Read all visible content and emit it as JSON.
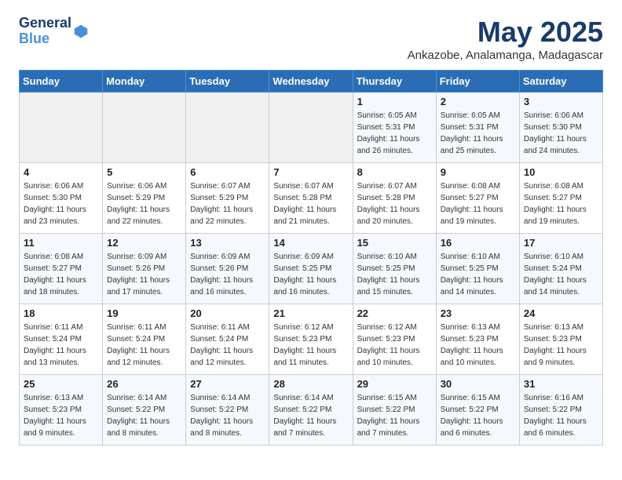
{
  "header": {
    "logo_line1": "General",
    "logo_line2": "Blue",
    "month": "May 2025",
    "location": "Ankazobe, Analamanga, Madagascar"
  },
  "weekdays": [
    "Sunday",
    "Monday",
    "Tuesday",
    "Wednesday",
    "Thursday",
    "Friday",
    "Saturday"
  ],
  "weeks": [
    [
      {
        "day": "",
        "sunrise": "",
        "sunset": "",
        "daylight": ""
      },
      {
        "day": "",
        "sunrise": "",
        "sunset": "",
        "daylight": ""
      },
      {
        "day": "",
        "sunrise": "",
        "sunset": "",
        "daylight": ""
      },
      {
        "day": "",
        "sunrise": "",
        "sunset": "",
        "daylight": ""
      },
      {
        "day": "1",
        "sunrise": "6:05 AM",
        "sunset": "5:31 PM",
        "daylight": "11 hours and 26 minutes."
      },
      {
        "day": "2",
        "sunrise": "6:05 AM",
        "sunset": "5:31 PM",
        "daylight": "11 hours and 25 minutes."
      },
      {
        "day": "3",
        "sunrise": "6:06 AM",
        "sunset": "5:30 PM",
        "daylight": "11 hours and 24 minutes."
      }
    ],
    [
      {
        "day": "4",
        "sunrise": "6:06 AM",
        "sunset": "5:30 PM",
        "daylight": "11 hours and 23 minutes."
      },
      {
        "day": "5",
        "sunrise": "6:06 AM",
        "sunset": "5:29 PM",
        "daylight": "11 hours and 22 minutes."
      },
      {
        "day": "6",
        "sunrise": "6:07 AM",
        "sunset": "5:29 PM",
        "daylight": "11 hours and 22 minutes."
      },
      {
        "day": "7",
        "sunrise": "6:07 AM",
        "sunset": "5:28 PM",
        "daylight": "11 hours and 21 minutes."
      },
      {
        "day": "8",
        "sunrise": "6:07 AM",
        "sunset": "5:28 PM",
        "daylight": "11 hours and 20 minutes."
      },
      {
        "day": "9",
        "sunrise": "6:08 AM",
        "sunset": "5:27 PM",
        "daylight": "11 hours and 19 minutes."
      },
      {
        "day": "10",
        "sunrise": "6:08 AM",
        "sunset": "5:27 PM",
        "daylight": "11 hours and 19 minutes."
      }
    ],
    [
      {
        "day": "11",
        "sunrise": "6:08 AM",
        "sunset": "5:27 PM",
        "daylight": "11 hours and 18 minutes."
      },
      {
        "day": "12",
        "sunrise": "6:09 AM",
        "sunset": "5:26 PM",
        "daylight": "11 hours and 17 minutes."
      },
      {
        "day": "13",
        "sunrise": "6:09 AM",
        "sunset": "5:26 PM",
        "daylight": "11 hours and 16 minutes."
      },
      {
        "day": "14",
        "sunrise": "6:09 AM",
        "sunset": "5:25 PM",
        "daylight": "11 hours and 16 minutes."
      },
      {
        "day": "15",
        "sunrise": "6:10 AM",
        "sunset": "5:25 PM",
        "daylight": "11 hours and 15 minutes."
      },
      {
        "day": "16",
        "sunrise": "6:10 AM",
        "sunset": "5:25 PM",
        "daylight": "11 hours and 14 minutes."
      },
      {
        "day": "17",
        "sunrise": "6:10 AM",
        "sunset": "5:24 PM",
        "daylight": "11 hours and 14 minutes."
      }
    ],
    [
      {
        "day": "18",
        "sunrise": "6:11 AM",
        "sunset": "5:24 PM",
        "daylight": "11 hours and 13 minutes."
      },
      {
        "day": "19",
        "sunrise": "6:11 AM",
        "sunset": "5:24 PM",
        "daylight": "11 hours and 12 minutes."
      },
      {
        "day": "20",
        "sunrise": "6:11 AM",
        "sunset": "5:24 PM",
        "daylight": "11 hours and 12 minutes."
      },
      {
        "day": "21",
        "sunrise": "6:12 AM",
        "sunset": "5:23 PM",
        "daylight": "11 hours and 11 minutes."
      },
      {
        "day": "22",
        "sunrise": "6:12 AM",
        "sunset": "5:23 PM",
        "daylight": "11 hours and 10 minutes."
      },
      {
        "day": "23",
        "sunrise": "6:13 AM",
        "sunset": "5:23 PM",
        "daylight": "11 hours and 10 minutes."
      },
      {
        "day": "24",
        "sunrise": "6:13 AM",
        "sunset": "5:23 PM",
        "daylight": "11 hours and 9 minutes."
      }
    ],
    [
      {
        "day": "25",
        "sunrise": "6:13 AM",
        "sunset": "5:23 PM",
        "daylight": "11 hours and 9 minutes."
      },
      {
        "day": "26",
        "sunrise": "6:14 AM",
        "sunset": "5:22 PM",
        "daylight": "11 hours and 8 minutes."
      },
      {
        "day": "27",
        "sunrise": "6:14 AM",
        "sunset": "5:22 PM",
        "daylight": "11 hours and 8 minutes."
      },
      {
        "day": "28",
        "sunrise": "6:14 AM",
        "sunset": "5:22 PM",
        "daylight": "11 hours and 7 minutes."
      },
      {
        "day": "29",
        "sunrise": "6:15 AM",
        "sunset": "5:22 PM",
        "daylight": "11 hours and 7 minutes."
      },
      {
        "day": "30",
        "sunrise": "6:15 AM",
        "sunset": "5:22 PM",
        "daylight": "11 hours and 6 minutes."
      },
      {
        "day": "31",
        "sunrise": "6:16 AM",
        "sunset": "5:22 PM",
        "daylight": "11 hours and 6 minutes."
      }
    ]
  ],
  "labels": {
    "sunrise": "Sunrise:",
    "sunset": "Sunset:",
    "daylight": "Daylight hours"
  }
}
